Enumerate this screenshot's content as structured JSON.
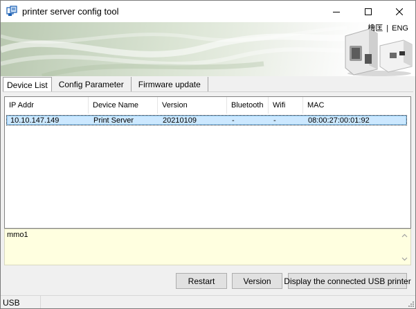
{
  "window": {
    "title": "printer server config tool",
    "icon": "printer-app-icon",
    "controls": [
      "minimize-icon",
      "maximize-icon",
      "close-icon"
    ]
  },
  "banner": {
    "lang_local": "橹匡",
    "lang_sep": "|",
    "lang_english": "ENG"
  },
  "tabs": [
    {
      "label": "Device List",
      "active": true
    },
    {
      "label": "Config Parameter",
      "active": false
    },
    {
      "label": "Firmware update",
      "active": false
    }
  ],
  "device_list": {
    "columns": [
      "IP Addr",
      "Device Name",
      "Version",
      "Bluetooth",
      "Wifi",
      "MAC"
    ],
    "rows": [
      {
        "ip": "10.10.147.149",
        "name": "Print Server",
        "version": "20210109",
        "bluetooth": "-",
        "wifi": "-",
        "mac": "08:00:27:00:01:92",
        "selected": true
      }
    ]
  },
  "memo": {
    "text": "mmo1"
  },
  "buttons": {
    "restart": "Restart",
    "version": "Version",
    "usb": "Display the connected USB printer"
  },
  "statusbar": {
    "panel1": "USB"
  },
  "colors": {
    "selection_bg": "#cce8ff",
    "memo_bg": "#ffffe0",
    "button_bg": "#e1e1e1"
  }
}
